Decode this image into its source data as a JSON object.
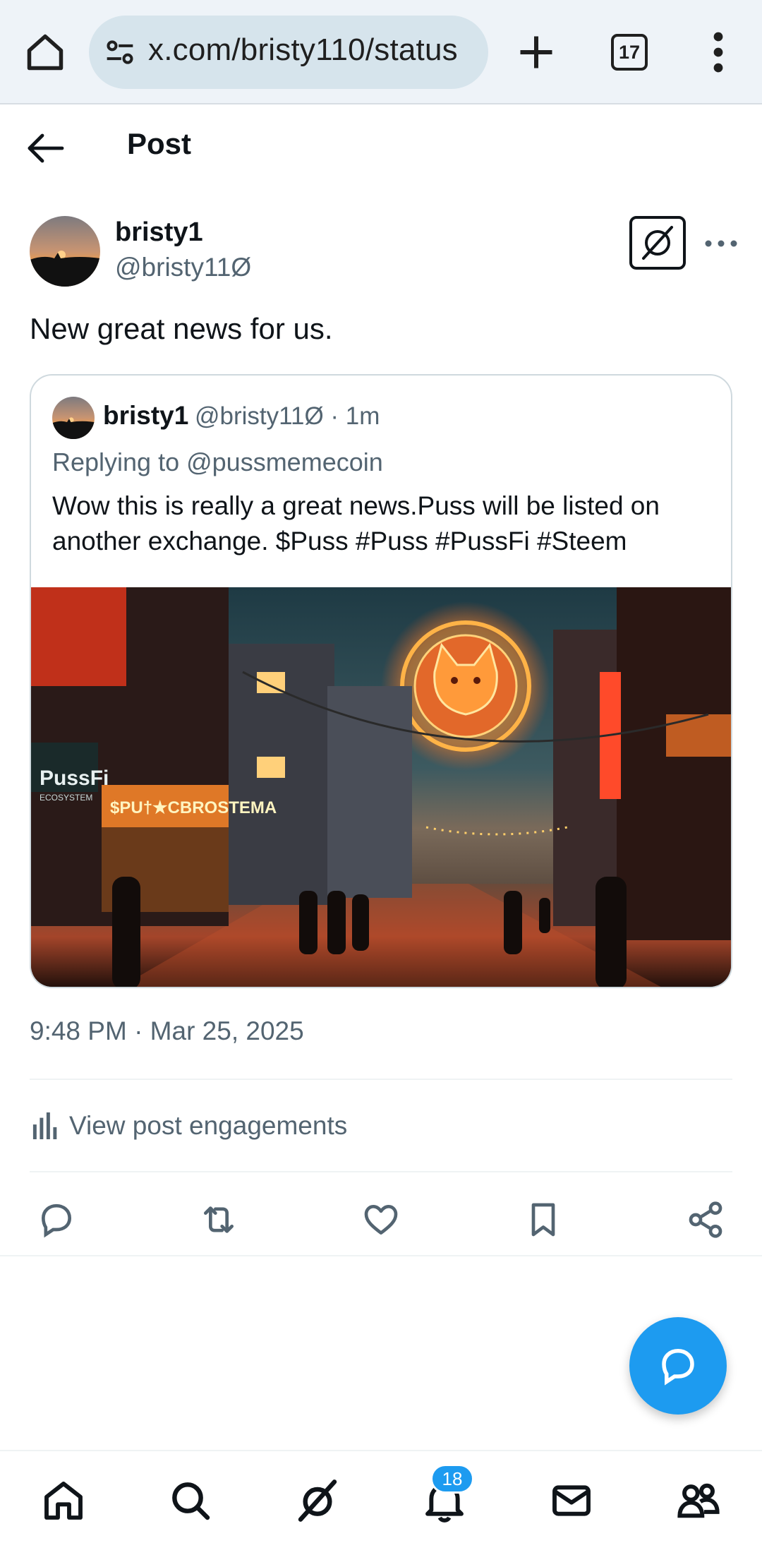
{
  "browser": {
    "url": "x.com/bristy110/status",
    "tab_count": "17"
  },
  "header": {
    "title": "Post"
  },
  "post": {
    "author_name": "bristy1",
    "author_handle": "@bristy11Ø",
    "text": "New great news for us.",
    "timestamp": "9:48 PM · Mar 25, 2025",
    "engagements_label": "View post engagements"
  },
  "quote": {
    "author_name": "bristy1",
    "meta": "@bristy11Ø · 1m",
    "replying_to": "Replying to @pussmemecoin",
    "text": "Wow this is really a great news.Puss will be listed on another exchange. $Puss #Puss #PussFi #Steem",
    "image_signs": [
      "PussFi",
      "$PU†★CBROSTEMA",
      "ECOSYSTEM"
    ]
  },
  "bottom_nav": {
    "notification_count": "18",
    "items": [
      "home-icon",
      "search-icon",
      "grok-icon",
      "notifications-icon",
      "messages-icon",
      "communities-icon"
    ]
  },
  "colors": {
    "accent": "#1d9bf0",
    "text_primary": "#0f1419",
    "text_secondary": "#536471"
  }
}
